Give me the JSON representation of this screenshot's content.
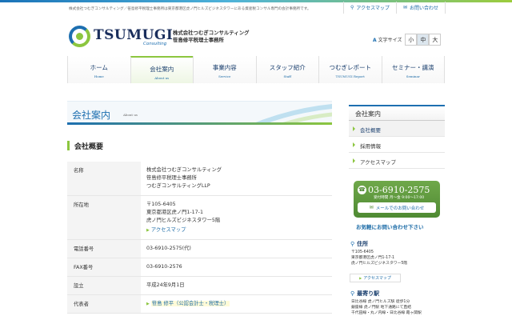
{
  "header": {
    "description": "株式会社つむぎコンサルティング／笹島修平税理士事務所は東京都港区虎ノ門ヒルズビジネスタワーにある資産税コンサル専門の会計事務所です。",
    "links": [
      {
        "icon": "map-pin-icon",
        "label": "アクセスマップ"
      },
      {
        "icon": "mail-icon",
        "label": "お問い合わせ"
      }
    ],
    "logo_text": "TSUMUGI",
    "logo_sub": "Consulting",
    "company_lines": [
      "株式会社つむぎコンサルティング",
      "笹島修平税理士事務所"
    ],
    "text_size": {
      "label": "文字サイズ",
      "options": [
        "小",
        "中",
        "大"
      ],
      "selected": "中"
    }
  },
  "nav": {
    "items": [
      {
        "label": "ホーム",
        "sub": "Home"
      },
      {
        "label": "会社案内",
        "sub": "About us",
        "active": true
      },
      {
        "label": "事業内容",
        "sub": "Service"
      },
      {
        "label": "スタッフ紹介",
        "sub": "Staff"
      },
      {
        "label": "つむぎレポート",
        "sub": "TSUMUGI Report"
      },
      {
        "label": "セミナー・講演",
        "sub": "Seminar"
      }
    ]
  },
  "banner": {
    "title": "会社案内",
    "sub": "About us"
  },
  "section": {
    "title": "会社概要"
  },
  "info": {
    "name_label": "名称",
    "name_lines": [
      "株式会社つむぎコンサルティング",
      "笹島修平税理士事務所",
      "つむぎコンサルティングLLP"
    ],
    "addr_label": "所在地",
    "addr_lines": [
      "〒105-6405",
      "東京都港区虎ノ門1-17-1",
      "虎ノ門ヒルズビジネスタワー5階"
    ],
    "addr_link": "アクセスマップ",
    "tel_label": "電話番号",
    "tel_value": "03-6910-2575(代)",
    "fax_label": "FAX番号",
    "fax_value": "03-6910-2576",
    "est_label": "設立",
    "est_value": "平成24年9月1日",
    "rep_label": "代表者",
    "rep_value": "笹島 修平（公認会計士・税理士）"
  },
  "sidebar": {
    "title": "会社案内",
    "items": [
      {
        "label": "会社概要",
        "active": true
      },
      {
        "label": "採用情報"
      },
      {
        "label": "アクセスマップ"
      }
    ]
  },
  "contact": {
    "phone": "03-6910-2575",
    "hours": "受付時間 月～金 9:00～17:00",
    "mail_label": "メールでのお問い合わせ",
    "easy_text": "お気軽にお問い合わせ下さい"
  },
  "address_box": {
    "title": "住所",
    "lines": [
      "〒105-6405",
      "東京都港区虎ノ門1-17-1",
      "虎ノ門ヒルズビジネスタワー5階"
    ],
    "link": "アクセスマップ"
  },
  "nearest": {
    "title": "最寄り駅",
    "lines": [
      "日比谷線 虎ノ門ヒルズ駅 徒歩1分",
      "銀座線 虎ノ門駅 地下通路にて直結",
      "千代田線・丸ノ内線・日比谷線 霞ヶ関駅"
    ]
  },
  "colors": {
    "brand_blue": "#1d6fb0",
    "brand_green": "#8cc63f",
    "contact_green": "#5b9a3c"
  }
}
